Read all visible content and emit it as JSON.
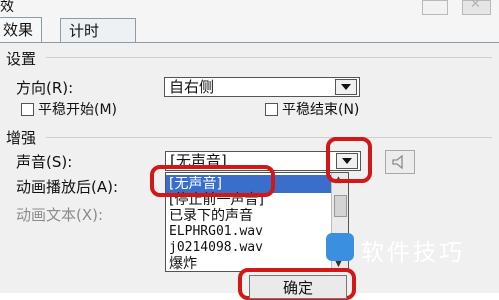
{
  "window": {
    "title": "效",
    "close_symbol": "✕"
  },
  "tabs": [
    {
      "label": "效果"
    },
    {
      "label": "计时"
    }
  ],
  "settings": {
    "section": "设置",
    "direction_label": "方向(R):",
    "direction_value": "自右侧",
    "smooth_start_label": "平稳开始(M)",
    "smooth_end_label": "平稳结束(N)"
  },
  "enhance": {
    "section": "增强",
    "sound_label": "声音(S):",
    "sound_value": "[无声音]",
    "after_anim_label": "动画播放后(A):",
    "anim_text_label": "动画文本(X):"
  },
  "sound_list": [
    "[无声音]",
    "[停止前一声音]",
    "已录下的声音",
    "ELPHRG01.wav",
    "j0214098.wav",
    "爆炸"
  ],
  "buttons": {
    "ok": "确定"
  },
  "watermark": {
    "text": "软件技巧"
  },
  "colors": {
    "highlight": "#3a6ecb",
    "annotation": "#d21717"
  }
}
